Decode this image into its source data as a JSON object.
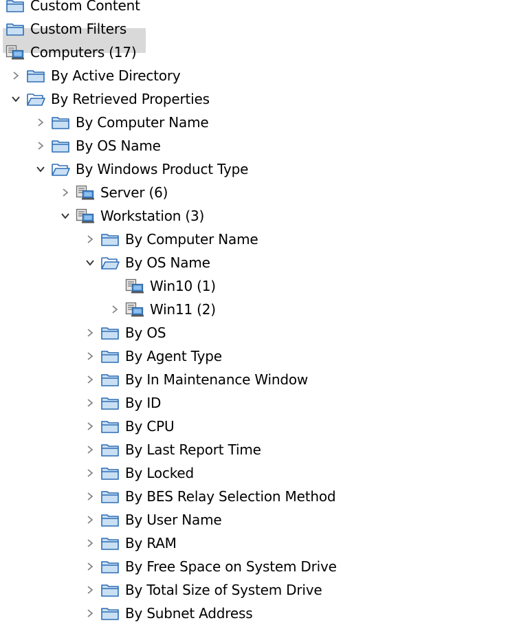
{
  "tree": {
    "items": [
      {
        "label": "Custom Content",
        "icon": "folder-icon",
        "expander": "none",
        "level": 0
      },
      {
        "label": "Custom Filters",
        "icon": "folder-icon",
        "expander": "none",
        "level": 0
      },
      {
        "label": "Computers (17)",
        "icon": "computer-group-icon",
        "expander": "none",
        "level": 0,
        "selected": true
      },
      {
        "label": "By Active Directory",
        "icon": "folder-icon",
        "expander": "collapsed",
        "level": 1
      },
      {
        "label": "By Retrieved Properties",
        "icon": "folder-open-icon",
        "expander": "expanded",
        "level": 1
      },
      {
        "label": "By Computer Name",
        "icon": "folder-icon",
        "expander": "collapsed",
        "level": 2
      },
      {
        "label": "By OS Name",
        "icon": "folder-icon",
        "expander": "collapsed",
        "level": 2
      },
      {
        "label": "By Windows Product Type",
        "icon": "folder-open-icon",
        "expander": "expanded",
        "level": 2
      },
      {
        "label": "Server (6)",
        "icon": "computer-group-icon",
        "expander": "collapsed",
        "level": 3
      },
      {
        "label": "Workstation (3)",
        "icon": "computer-group-icon",
        "expander": "expanded",
        "level": 3
      },
      {
        "label": "By Computer Name",
        "icon": "folder-icon",
        "expander": "collapsed",
        "level": 4
      },
      {
        "label": "By OS Name",
        "icon": "folder-open-icon",
        "expander": "expanded",
        "level": 4
      },
      {
        "label": "Win10 (1)",
        "icon": "computer-group-icon",
        "expander": "none",
        "level": 5
      },
      {
        "label": "Win11 (2)",
        "icon": "computer-group-icon",
        "expander": "collapsed",
        "level": 5
      },
      {
        "label": "By OS",
        "icon": "folder-icon",
        "expander": "collapsed",
        "level": 4
      },
      {
        "label": "By Agent Type",
        "icon": "folder-icon",
        "expander": "collapsed",
        "level": 4
      },
      {
        "label": "By In Maintenance Window",
        "icon": "folder-icon",
        "expander": "collapsed",
        "level": 4
      },
      {
        "label": "By ID",
        "icon": "folder-icon",
        "expander": "collapsed",
        "level": 4
      },
      {
        "label": "By CPU",
        "icon": "folder-icon",
        "expander": "collapsed",
        "level": 4
      },
      {
        "label": "By Last Report Time",
        "icon": "folder-icon",
        "expander": "collapsed",
        "level": 4
      },
      {
        "label": "By Locked",
        "icon": "folder-icon",
        "expander": "collapsed",
        "level": 4
      },
      {
        "label": "By BES Relay Selection Method",
        "icon": "folder-icon",
        "expander": "collapsed",
        "level": 4
      },
      {
        "label": "By User Name",
        "icon": "folder-icon",
        "expander": "collapsed",
        "level": 4
      },
      {
        "label": "By RAM",
        "icon": "folder-icon",
        "expander": "collapsed",
        "level": 4
      },
      {
        "label": "By Free Space on System Drive",
        "icon": "folder-icon",
        "expander": "collapsed",
        "level": 4
      },
      {
        "label": "By Total Size of System Drive",
        "icon": "folder-icon",
        "expander": "collapsed",
        "level": 4
      },
      {
        "label": "By Subnet Address",
        "icon": "folder-icon",
        "expander": "collapsed",
        "level": 4
      }
    ]
  },
  "colors": {
    "selection": "#d9d9d9",
    "folder_fill": "#c9dff3",
    "folder_stroke": "#2d6db5",
    "chevron": "#808080",
    "text": "#000000"
  }
}
